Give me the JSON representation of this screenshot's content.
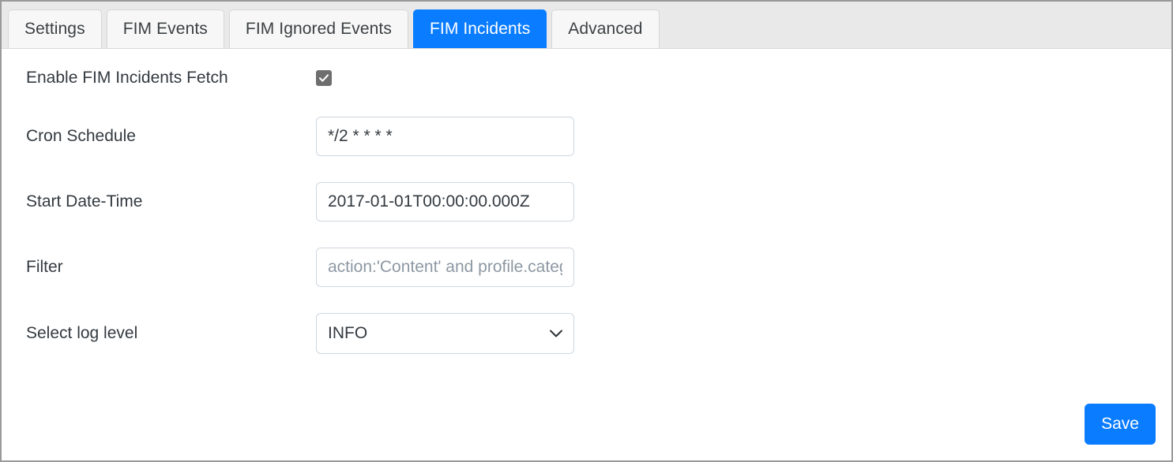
{
  "tabs": [
    {
      "label": "Settings",
      "active": false
    },
    {
      "label": "FIM Events",
      "active": false
    },
    {
      "label": "FIM Ignored Events",
      "active": false
    },
    {
      "label": "FIM Incidents",
      "active": true
    },
    {
      "label": "Advanced",
      "active": false
    }
  ],
  "form": {
    "enable_fetch": {
      "label": "Enable FIM Incidents Fetch",
      "checked": true
    },
    "cron_schedule": {
      "label": "Cron Schedule",
      "value": "*/2 * * * *",
      "placeholder": ""
    },
    "start_date_time": {
      "label": "Start Date-Time",
      "value": "2017-01-01T00:00:00.000Z",
      "placeholder": ""
    },
    "filter": {
      "label": "Filter",
      "value": "",
      "placeholder": "action:'Content' and profile.category:'Malware'"
    },
    "log_level": {
      "label": "Select log level",
      "value": "INFO",
      "options": [
        "INFO"
      ]
    }
  },
  "actions": {
    "save_label": "Save"
  },
  "colors": {
    "accent": "#0a7cff",
    "tab_strip_bg": "#e9e9e9",
    "input_border": "#ced7e0",
    "checkbox_fill": "#6e6e6e"
  }
}
